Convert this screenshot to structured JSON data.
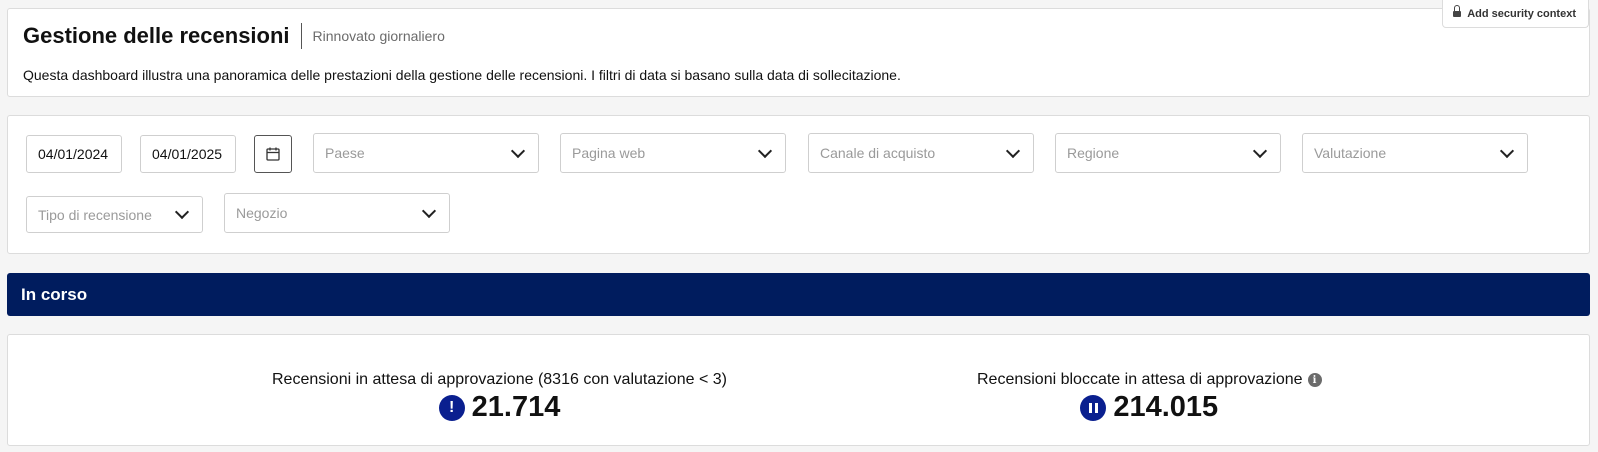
{
  "header": {
    "title": "Gestione delle recensioni",
    "refresh_note": "Rinnovato giornaliero",
    "description": "Questa dashboard illustra una panoramica delle prestazioni della gestione delle recensioni. I filtri di data si basano sulla data di sollecitazione.",
    "security_button": "Add security context"
  },
  "filters": {
    "start_date": "04/01/2024",
    "end_date": "04/01/2025",
    "selects": [
      {
        "placeholder": "Paese"
      },
      {
        "placeholder": "Pagina web"
      },
      {
        "placeholder": "Canale di acquisto"
      },
      {
        "placeholder": "Regione"
      },
      {
        "placeholder": "Valutazione"
      },
      {
        "placeholder": "Tipo di recensione"
      },
      {
        "placeholder": "Negozio"
      }
    ]
  },
  "section": {
    "title": "In corso"
  },
  "kpis": [
    {
      "label": "Recensioni in attesa di approvazione (8316 con valutazione < 3)",
      "value": "21.714",
      "icon": "exclamation-icon"
    },
    {
      "label": "Recensioni bloccate in attesa di approvazione",
      "value": "214.015",
      "icon": "pause-icon"
    }
  ],
  "colors": {
    "banner": "#001c5e",
    "kpi_icon": "#0a1f8f"
  }
}
